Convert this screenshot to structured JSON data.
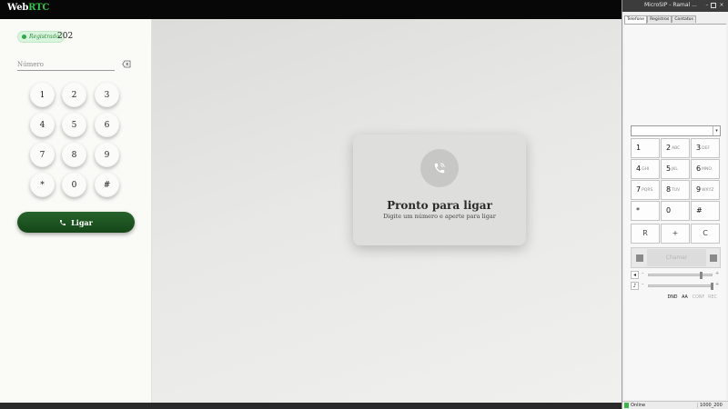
{
  "app": {
    "brand_prefix": "Web",
    "brand_accent": "RTC",
    "accent_color": "#35c24a"
  },
  "status": {
    "badge": "Registrado",
    "extension": "202"
  },
  "dialer": {
    "placeholder": "Número",
    "backspace_icon": "backspace-icon",
    "keys": [
      "1",
      "2",
      "3",
      "4",
      "5",
      "6",
      "7",
      "8",
      "9",
      "*",
      "0",
      "#"
    ],
    "call_label": "Ligar",
    "call_color": "#1e5522"
  },
  "ready": {
    "title": "Pronto para ligar",
    "subtitle": "Digite um número e aperte para ligar",
    "icon": "phone-call-icon"
  },
  "microsip": {
    "title": "MicroSIP - Ramal ...",
    "tabs": [
      "Telefone",
      "Registros",
      "Contatos"
    ],
    "active_tab": "Telefone",
    "keys": [
      {
        "digit": "1",
        "letters": ""
      },
      {
        "digit": "2",
        "letters": "ABC"
      },
      {
        "digit": "3",
        "letters": "DEF"
      },
      {
        "digit": "4",
        "letters": "GHI"
      },
      {
        "digit": "5",
        "letters": "JKL"
      },
      {
        "digit": "6",
        "letters": "MNO"
      },
      {
        "digit": "7",
        "letters": "PQRS"
      },
      {
        "digit": "8",
        "letters": "TUV"
      },
      {
        "digit": "9",
        "letters": "WXYZ"
      },
      {
        "digit": "*",
        "letters": ""
      },
      {
        "digit": "0",
        "letters": ""
      },
      {
        "digit": "#",
        "letters": ""
      }
    ],
    "extra_keys": [
      "R",
      "+",
      "C"
    ],
    "call_label": "Chamar",
    "speaker_level": 0.82,
    "mic_level": 1.0,
    "buttons": {
      "dnd": "DND",
      "aa": "AA",
      "conf": "CONF",
      "rec": "REC"
    },
    "status_online": "Online",
    "account": "1000_200"
  }
}
